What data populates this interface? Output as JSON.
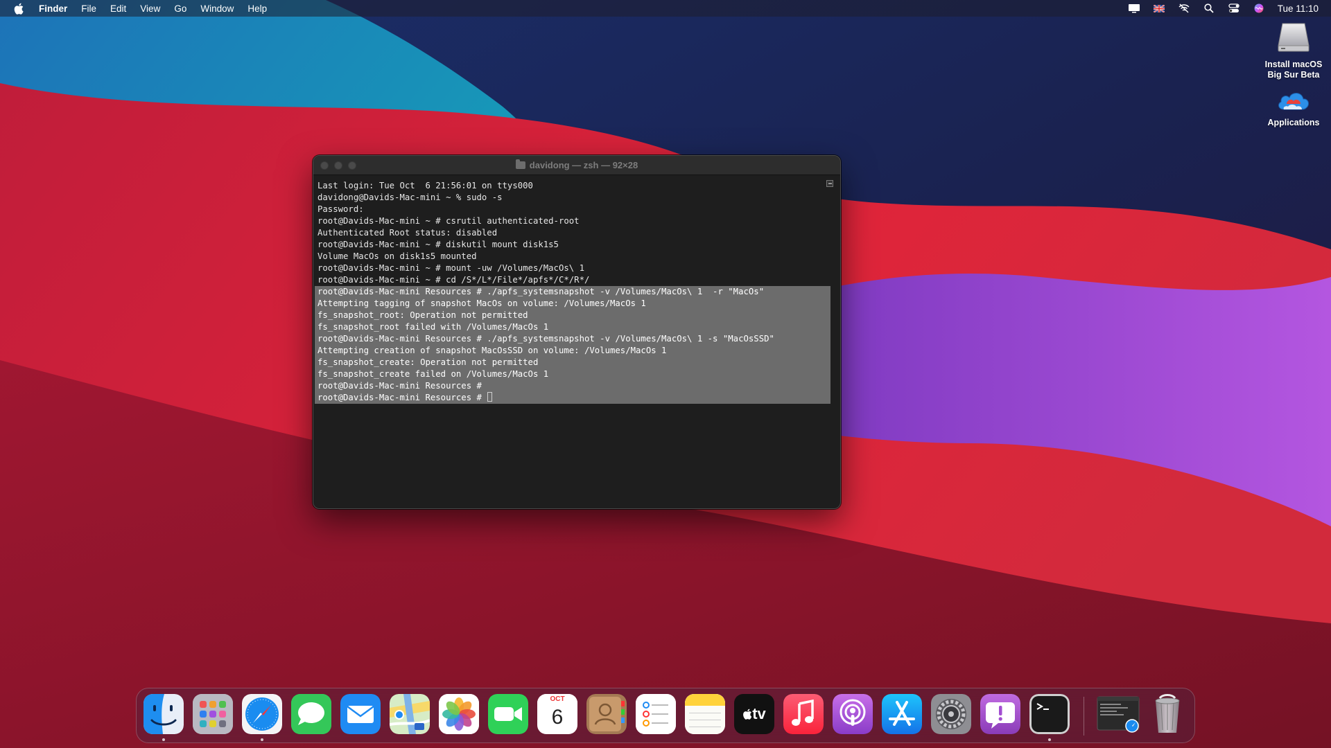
{
  "menubar": {
    "app_name": "Finder",
    "menus": [
      "File",
      "Edit",
      "View",
      "Go",
      "Window",
      "Help"
    ],
    "clock": "Tue 11:10",
    "status_icons": [
      "display-icon",
      "uk-flag-icon",
      "wifi-off-icon",
      "spotlight-search-icon",
      "control-center-icon",
      "siri-icon"
    ]
  },
  "desktop": {
    "icons": [
      {
        "label_line1": "Install macOS",
        "label_line2": "Big Sur Beta",
        "icon": "drive-icon"
      },
      {
        "label_line1": "Applications",
        "label_line2": "",
        "icon": "cloud-folder-icon"
      }
    ]
  },
  "terminal": {
    "title": "davidong — zsh — 92×28",
    "lines": [
      "Last login: Tue Oct  6 21:56:01 on ttys000",
      "davidong@Davids-Mac-mini ~ % sudo -s",
      "Password:",
      "root@Davids-Mac-mini ~ # csrutil authenticated-root",
      "Authenticated Root status: disabled",
      "root@Davids-Mac-mini ~ # diskutil mount disk1s5",
      "Volume MacOs on disk1s5 mounted",
      "root@Davids-Mac-mini ~ # mount -uw /Volumes/MacOs\\ 1",
      "root@Davids-Mac-mini ~ # cd /S*/L*/File*/apfs*/C*/R*/",
      "root@Davids-Mac-mini Resources # ./apfs_systemsnapshot -v /Volumes/MacOs\\ 1  -r \"MacOs\"",
      "Attempting tagging of snapshot MacOs on volume: /Volumes/MacOs 1",
      "fs_snapshot_root: Operation not permitted",
      "fs_snapshot_root failed with /Volumes/MacOs 1",
      "root@Davids-Mac-mini Resources # ./apfs_systemsnapshot -v /Volumes/MacOs\\ 1 -s \"MacOsSSD\"",
      "Attempting creation of snapshot MacOsSSD on volume: /Volumes/MacOs 1",
      "fs_snapshot_create: Operation not permitted",
      "fs_snapshot_create failed on /Volumes/MacOs 1",
      "root@Davids-Mac-mini Resources #",
      "root@Davids-Mac-mini Resources # "
    ]
  },
  "dock": {
    "apps": [
      "finder",
      "launchpad",
      "safari",
      "messages",
      "mail",
      "maps",
      "photos",
      "facetime",
      "calendar",
      "contacts",
      "reminders",
      "notes",
      "tv",
      "music",
      "podcasts",
      "app-store",
      "system-preferences",
      "feedback-assistant",
      "terminal"
    ],
    "calendar_month": "OCT",
    "calendar_day": "6",
    "tv_label": "tv"
  },
  "colors": {
    "selection": "#6c6c6c",
    "terminal_bg": "#1e1e1e",
    "titlebar_bg": "#2d2d2d"
  }
}
